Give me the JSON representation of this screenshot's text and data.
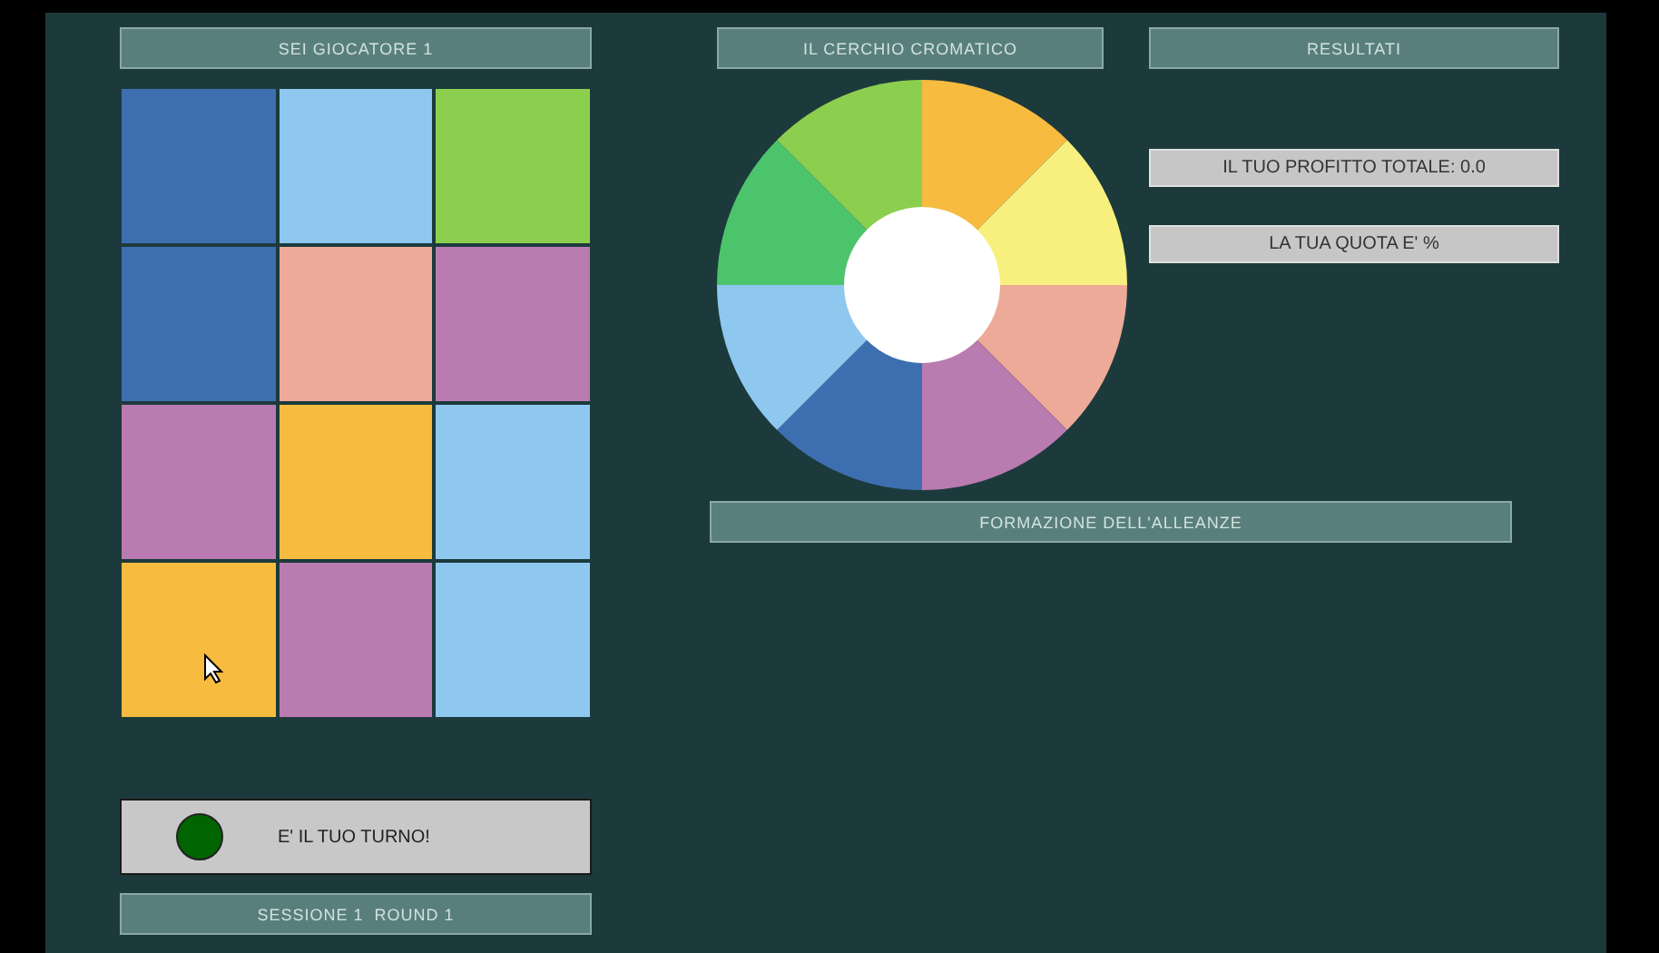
{
  "player_tab": "SEI GIOCATORE 1",
  "nav_buttons": [
    "IL CERCHIO CROMATICO",
    "RESULTATI"
  ],
  "grid": [
    {
      "color": "#3d6fb0"
    },
    {
      "color": "#8ec8ee"
    },
    {
      "color": "#8ccf4f"
    },
    {
      "color": "#3d6fb0"
    },
    {
      "color": "#eeaa98"
    },
    {
      "color": "#b97bb0"
    },
    {
      "color": "#b97bb0"
    },
    {
      "color": "#f6bb3f"
    },
    {
      "color": "#8ec8ee"
    },
    {
      "color": "#f6bb3f"
    },
    {
      "color": "#b97bb0"
    },
    {
      "color": "#8ec8ee"
    }
  ],
  "wheel": [
    {
      "color": "#f6bb3f"
    },
    {
      "color": "#f7f07e"
    },
    {
      "color": "#eeaa98"
    },
    {
      "color": "#b97bb0"
    },
    {
      "color": "#3d6fb0"
    },
    {
      "color": "#8ec8ee"
    },
    {
      "color": "#4cc46c"
    },
    {
      "color": "#8ccf4f"
    }
  ],
  "info": [
    "IL TUO PROFITTO TOTALE: 0.0",
    "LA TUA QUOTA E' %"
  ],
  "alliance_button": "FORMAZIONE DELL'ALLEANZE",
  "turn": {
    "text": "E' IL TUO TURNO!",
    "color": "#006400"
  },
  "session": "SESSIONE 1  ROUND 1"
}
